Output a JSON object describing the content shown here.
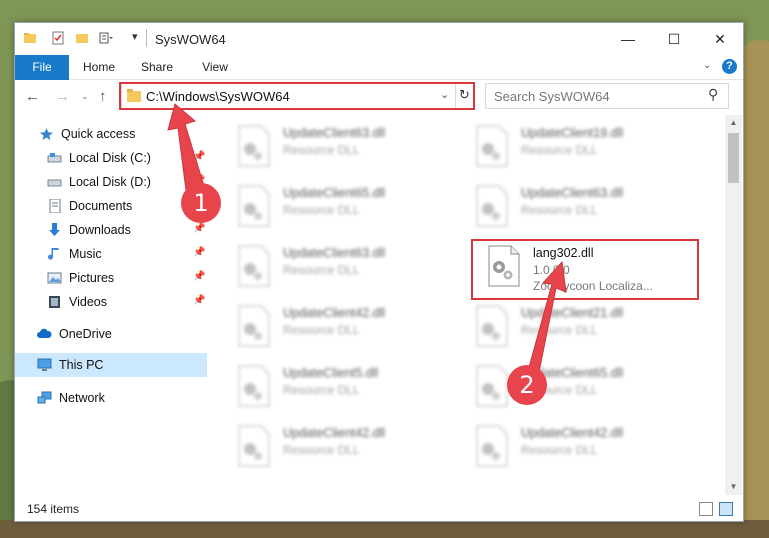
{
  "window": {
    "title": "SysWOW64"
  },
  "ribbon": {
    "tabs": [
      "File",
      "Home",
      "Share",
      "View"
    ],
    "help": "?"
  },
  "controls": {
    "minimize": "—",
    "maximize": "☐",
    "close": "✕"
  },
  "address": {
    "path": "C:\\Windows\\SysWOW64",
    "search_placeholder": "Search SysWOW64"
  },
  "nav": {
    "quick_access": "Quick access",
    "local_c": "Local Disk (C:)",
    "local_d": "Local Disk (D:)",
    "documents": "Documents",
    "downloads": "Downloads",
    "music": "Music",
    "pictures": "Pictures",
    "videos": "Videos",
    "onedrive": "OneDrive",
    "this_pc": "This PC",
    "network": "Network"
  },
  "files": {
    "f1": {
      "name": "UpdateClient63.dll",
      "desc": "Resource DLL"
    },
    "f2": {
      "name": "UpdateClient19.dll",
      "desc": "Resource DLL"
    },
    "f3": {
      "name": "UpdateClient65.dll",
      "desc": "Resource DLL"
    },
    "f4": {
      "name": "UpdateClient63.dll",
      "desc": "Resource DLL"
    },
    "f5": {
      "name": "UpdateClient63.dll",
      "desc": "Resource DLL"
    },
    "f6": {
      "name": "UpdateClient42.dll",
      "desc": "Resource DLL"
    },
    "f7": {
      "name": "UpdateClient21.dll",
      "desc": "Resource DLL"
    },
    "f8": {
      "name": "UpdateClient5.dll",
      "desc": "Resource DLL"
    },
    "f9": {
      "name": "UpdateClient65.dll",
      "desc": "Resource DLL"
    },
    "f10": {
      "name": "UpdateClient42.dll",
      "desc": "Resource DLL"
    },
    "f11": {
      "name": "UpdateClient42.dll",
      "desc": "Resource DLL"
    },
    "target": {
      "name": "lang302.dll",
      "version": "1.0.0.0",
      "desc": "Zoo Tycoon Localiza..."
    }
  },
  "status": {
    "items": "154 items"
  },
  "callouts": {
    "one": "1",
    "two": "2"
  },
  "colors": {
    "accent": "#1979ca",
    "highlight": "#d9363e",
    "selected": "#cce8ff"
  }
}
